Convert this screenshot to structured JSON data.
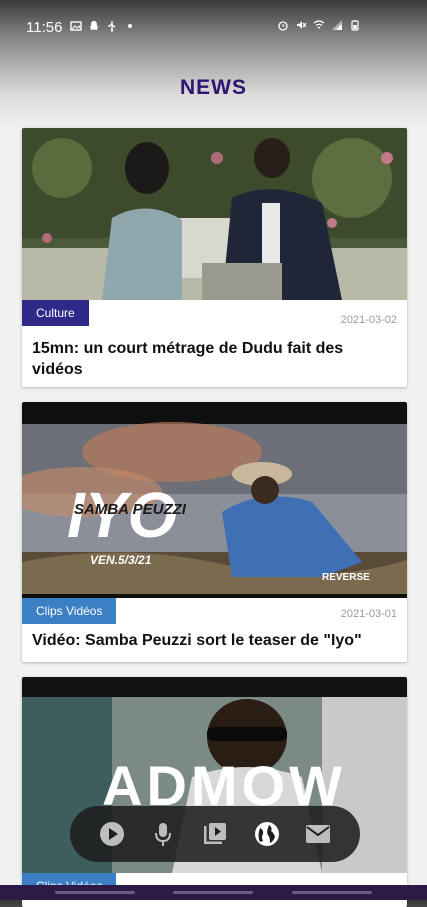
{
  "status_bar": {
    "time": "11:56",
    "left_icons": [
      "image-icon",
      "snapchat-icon",
      "usb-icon",
      "dot-icon"
    ],
    "right_icons": [
      "alarm-icon",
      "mute-icon",
      "wifi-icon",
      "signal-icon",
      "battery-icon"
    ]
  },
  "page": {
    "title": "NEWS"
  },
  "articles": [
    {
      "category": "Culture",
      "category_color": "#2f2a8a",
      "date": "2021-03-02",
      "title": "15mn: un court métrage de Dudu fait des vidéos"
    },
    {
      "category": "Clips Vidéos",
      "category_color": "#3b7fc4",
      "date": "2021-03-01",
      "title": "Vidéo: Samba Peuzzi sort le teaser de \"Iyo\"",
      "image_text": {
        "main": "IYO",
        "sub": "SAMBA PEUZZI",
        "small": "VEN.5/3/21",
        "brand": "REVERSE"
      }
    },
    {
      "category": "Clips Vidéos",
      "category_color": "#3b7fc4",
      "image_text": {
        "main": "ADMOW"
      }
    }
  ],
  "bottom_nav": {
    "items": [
      {
        "name": "play-icon"
      },
      {
        "name": "mic-icon"
      },
      {
        "name": "video-library-icon"
      },
      {
        "name": "globe-icon"
      },
      {
        "name": "mail-icon"
      }
    ]
  }
}
